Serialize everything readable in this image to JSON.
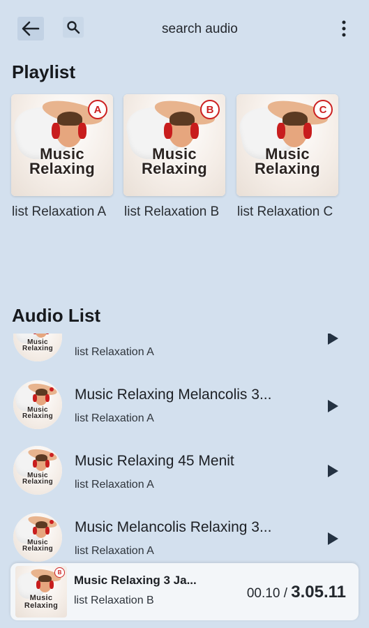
{
  "header": {
    "back_icon": "arrow-left-icon",
    "search_icon": "search-icon",
    "search_label": "search audio",
    "menu_icon": "more-vert-icon"
  },
  "playlist": {
    "title": "Playlist",
    "art_text": "Music Relaxing",
    "items": [
      {
        "label": "list Relaxation A",
        "badge": "A"
      },
      {
        "label": "list Relaxation B",
        "badge": "B"
      },
      {
        "label": "list Relaxation C",
        "badge": "C"
      }
    ]
  },
  "audio_list": {
    "title": "Audio List",
    "items": [
      {
        "title": "",
        "playlist": "list Relaxation A"
      },
      {
        "title": "Music Relaxing Melancolis 3...",
        "playlist": "list Relaxation A"
      },
      {
        "title": "Music Relaxing 45 Menit",
        "playlist": "list Relaxation A"
      },
      {
        "title": "Music Melancolis Relaxing 3...",
        "playlist": "list Relaxation A"
      }
    ]
  },
  "player": {
    "title": "Music Relaxing 3 Ja...",
    "playlist": "list Relaxation B",
    "badge": "B",
    "current_time": "00.10",
    "separator": "/",
    "total_time": "3.05.11"
  },
  "colors": {
    "background": "#d3e0ee",
    "badge_red": "#cc2020",
    "play_icon": "#243242"
  }
}
